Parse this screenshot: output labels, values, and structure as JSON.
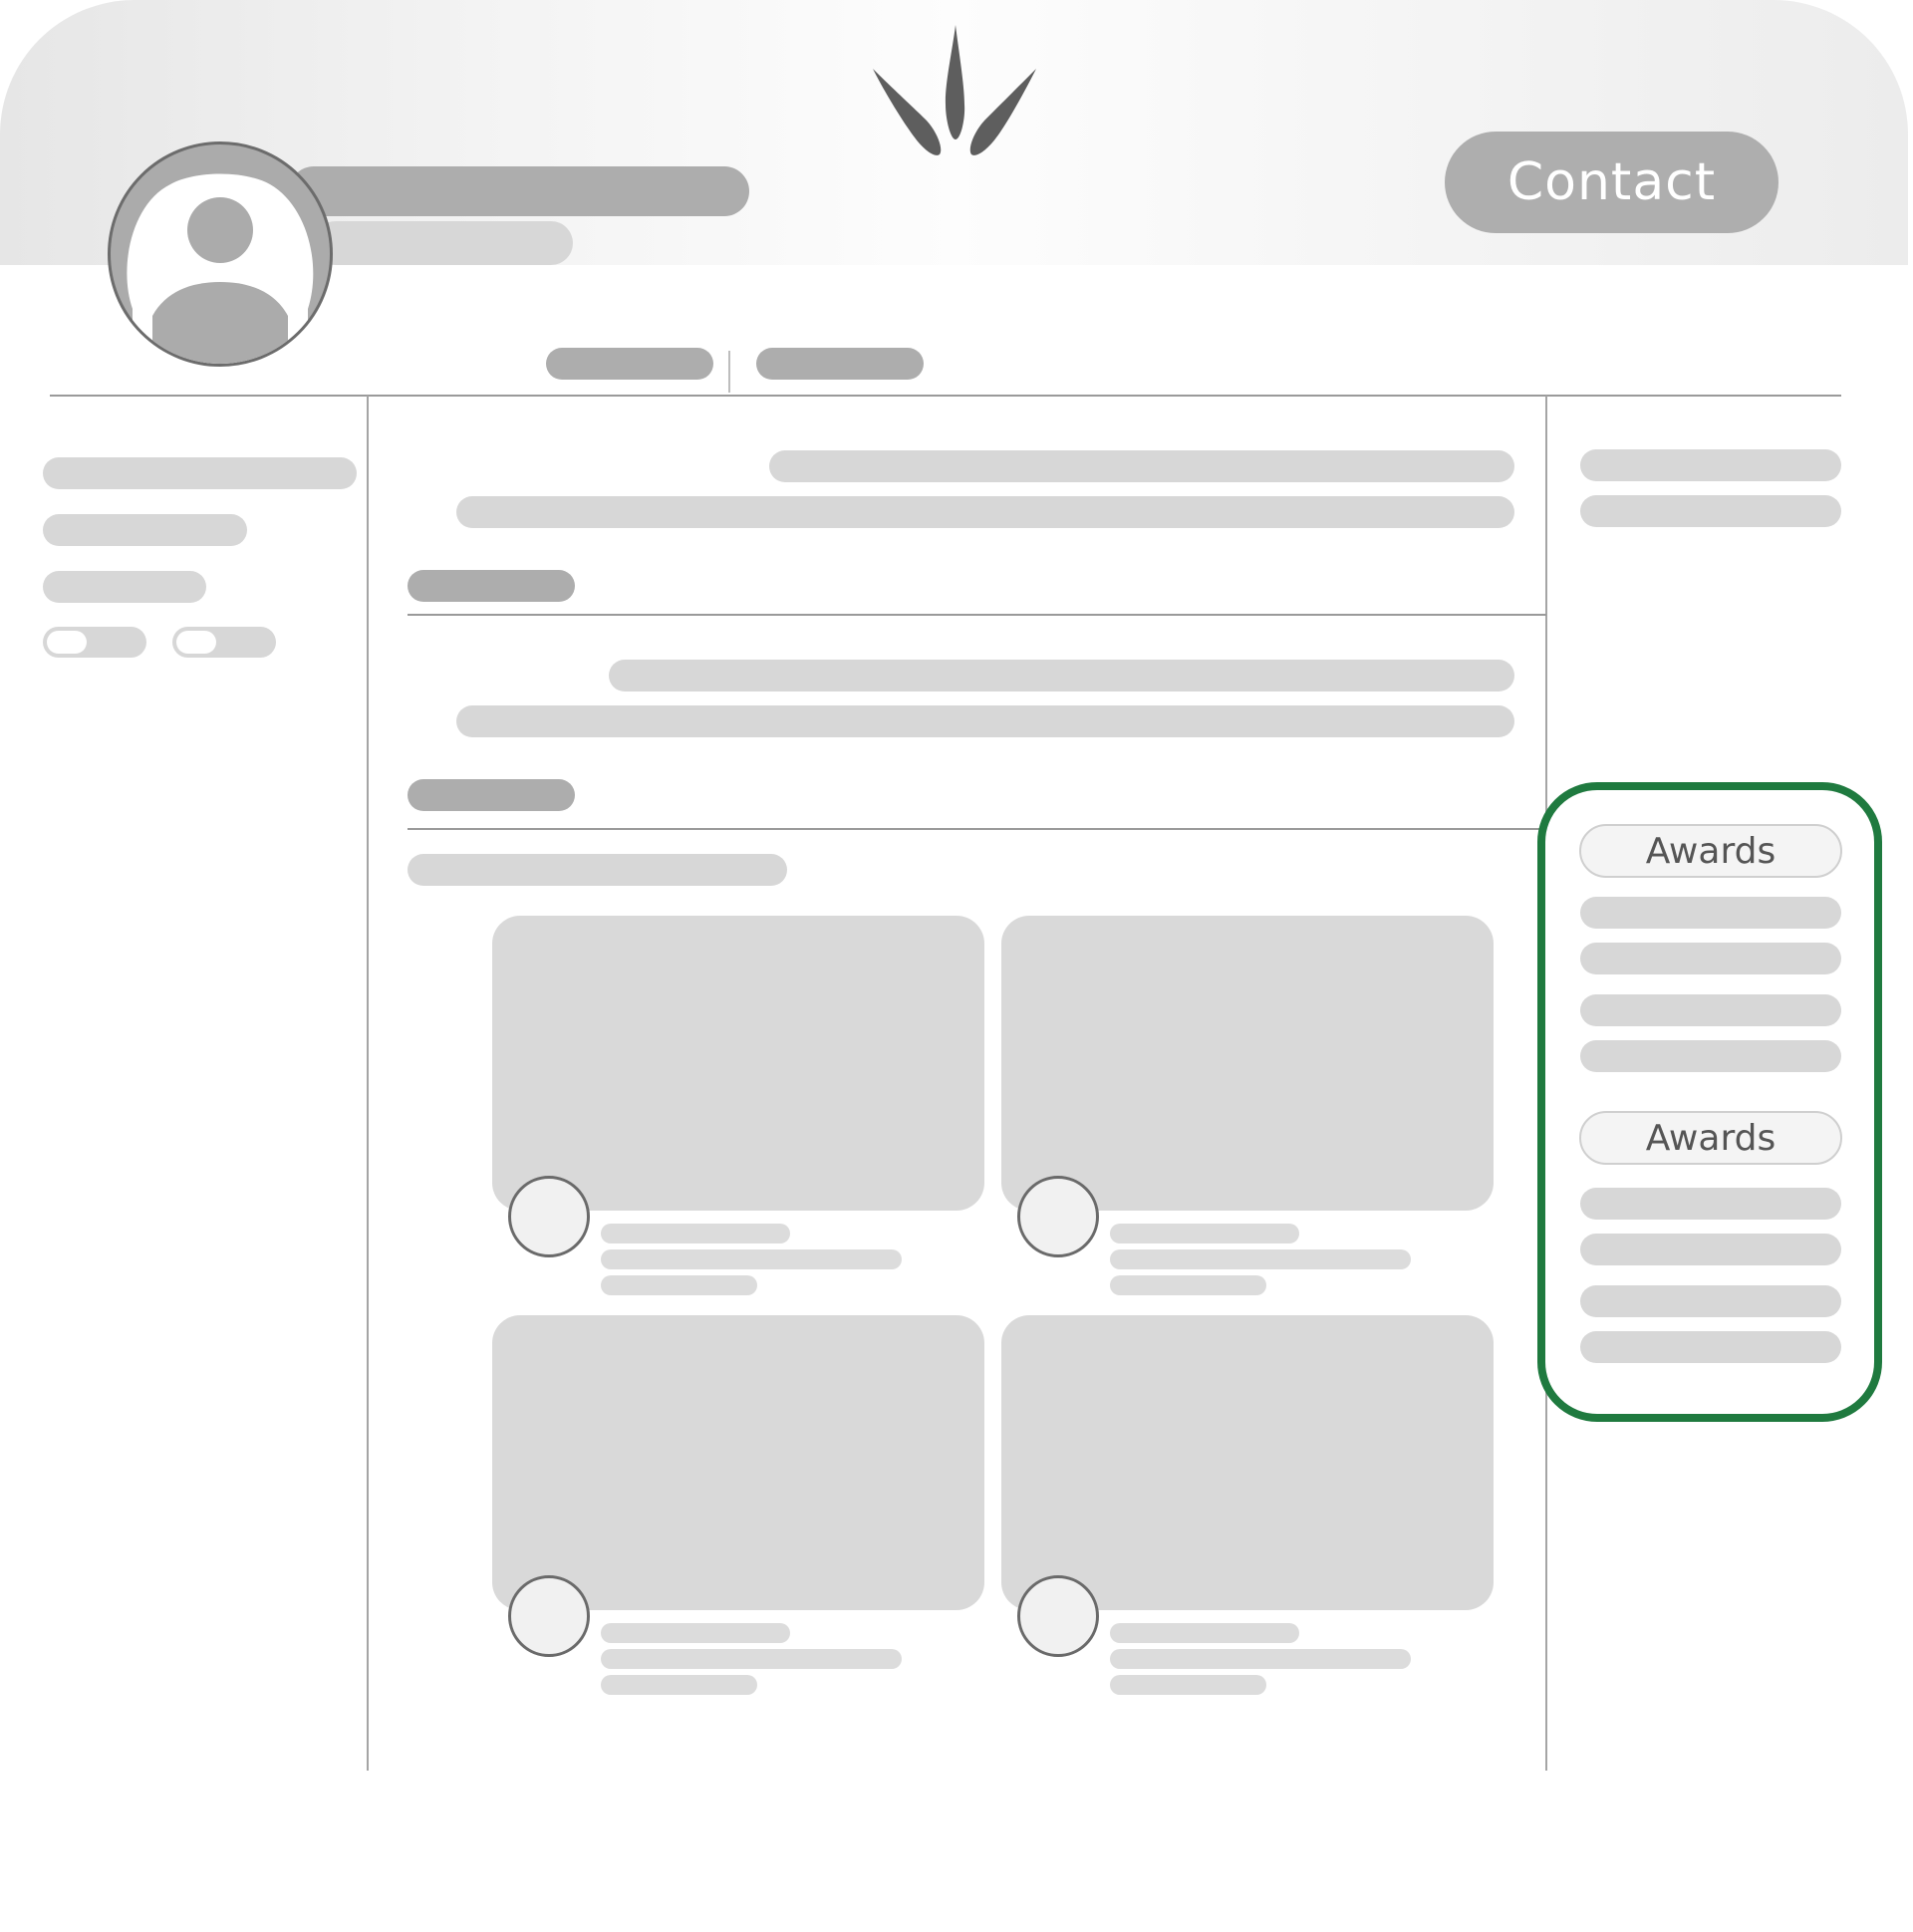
{
  "header": {
    "contact_label": "Contact",
    "logo_icon": "leaf-sprout-icon"
  },
  "profile": {
    "avatar_icon": "user-avatar-icon"
  },
  "awards": {
    "sections": [
      {
        "label": "Awards"
      },
      {
        "label": "Awards"
      }
    ]
  },
  "colors": {
    "accent_highlight": "#1f7a3f",
    "skeleton_dark": "#adadad",
    "skeleton_light": "#d7d7d7",
    "contact_button": "#aeaeae"
  }
}
